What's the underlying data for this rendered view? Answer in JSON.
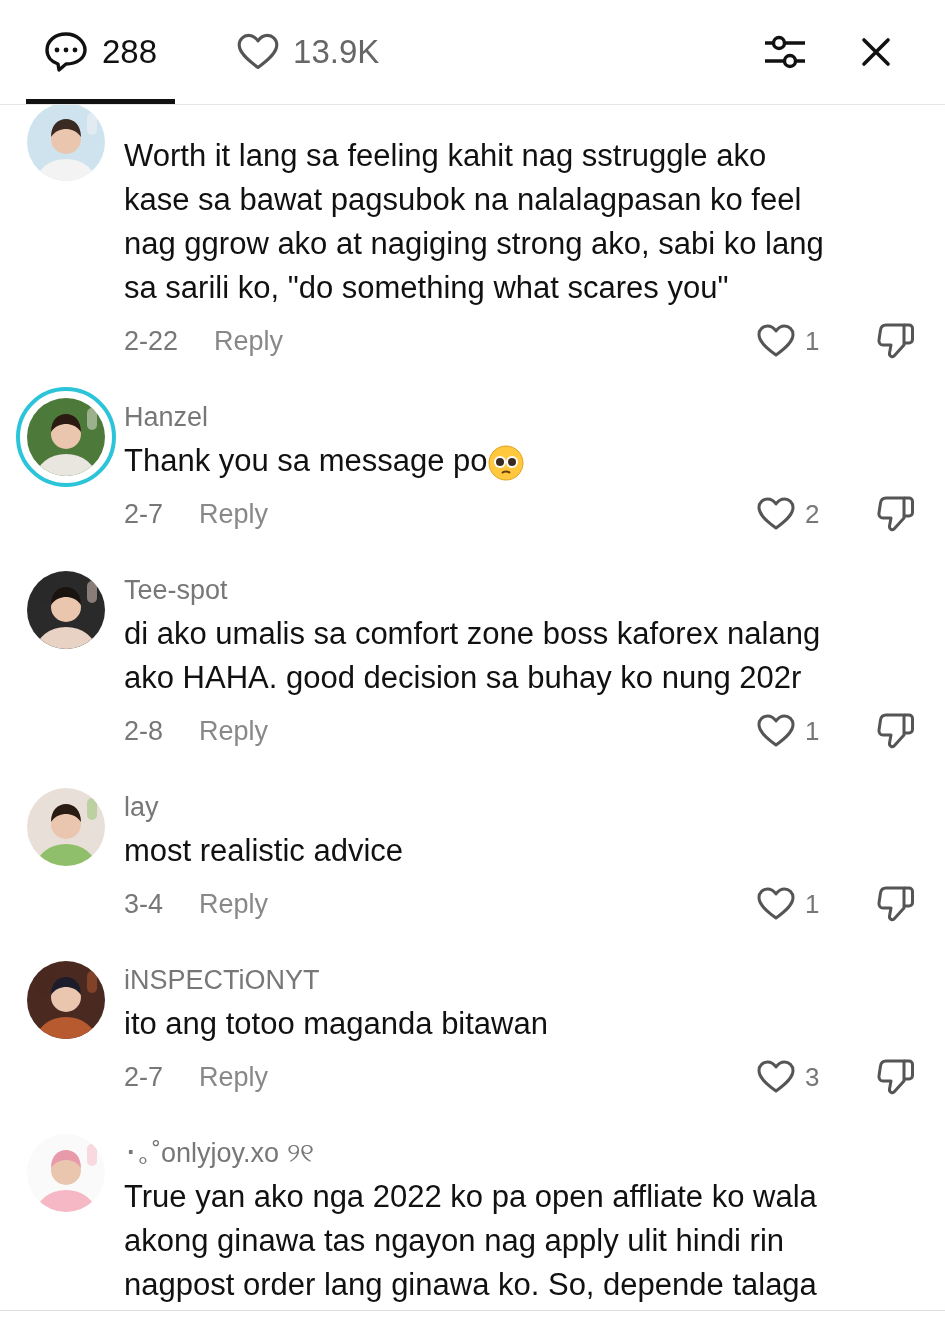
{
  "header": {
    "tabs": [
      {
        "kind": "comments",
        "label": "288",
        "selected": true
      },
      {
        "kind": "likes",
        "label": "13.9K",
        "selected": false
      }
    ]
  },
  "comments": [
    {
      "story_ring": false,
      "text": [
        "Worth it lang sa feeling kahit nag sstruggle ako",
        "kase sa bawat pagsubok na nalalagpasan ko feel",
        "nag ggrow ako at nagiging strong ako, sabi ko lang",
        "sa sarili ko, \"do something what scares you\""
      ],
      "emoji": false,
      "date": "2-22",
      "reply": "Reply",
      "likes": "1"
    },
    {
      "name": "Hanzel",
      "story_ring": true,
      "text": [
        "Thank you sa message po"
      ],
      "emoji": true,
      "date": "2-7",
      "reply": "Reply",
      "likes": "2"
    },
    {
      "name": "Tee-spot",
      "story_ring": false,
      "text": [
        "di ako umalis sa comfort zone boss kaforex nalang",
        "ako HAHA. good decision sa buhay ko nung 202r"
      ],
      "emoji": false,
      "date": "2-8",
      "reply": "Reply",
      "likes": "1"
    },
    {
      "name": "lay",
      "story_ring": false,
      "text": [
        "most realistic advice"
      ],
      "emoji": false,
      "date": "3-4",
      "reply": "Reply",
      "likes": "1"
    },
    {
      "name": "iNSPECTiONYT",
      "story_ring": false,
      "text": [
        "ito ang totoo maganda bitawan"
      ],
      "emoji": false,
      "date": "2-7",
      "reply": "Reply",
      "likes": "3"
    },
    {
      "name": "･｡˚onlyjoy.xo ୨୧",
      "story_ring": false,
      "text": [
        "True yan ako nga 2022 ko pa open affliate ko wala",
        "akong ginawa tas ngayon nag apply ulit hindi rin",
        "nagpost order lang ginawa ko. So, depende talaga"
      ],
      "emoji": false
    }
  ]
}
